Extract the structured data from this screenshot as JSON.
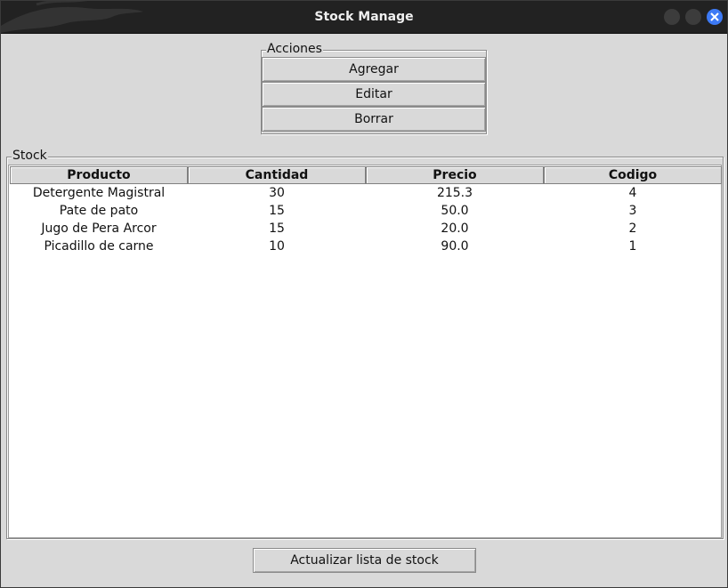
{
  "window": {
    "title": "Stock Manage",
    "close_color": "#3d7af5"
  },
  "acciones": {
    "label": "Acciones",
    "buttons": [
      "Agregar",
      "Editar",
      "Borrar"
    ]
  },
  "stock": {
    "label": "Stock",
    "columns": [
      "Producto",
      "Cantidad",
      "Precio",
      "Codigo"
    ],
    "rows": [
      [
        "Detergente Magistral",
        "30",
        "215.3",
        "4"
      ],
      [
        "Pate de pato",
        "15",
        "50.0",
        "3"
      ],
      [
        "Jugo de Pera Arcor",
        "15",
        "20.0",
        "2"
      ],
      [
        "Picadillo de carne",
        "10",
        "90.0",
        "1"
      ]
    ]
  },
  "footer": {
    "refresh_label": "Actualizar lista de stock"
  }
}
